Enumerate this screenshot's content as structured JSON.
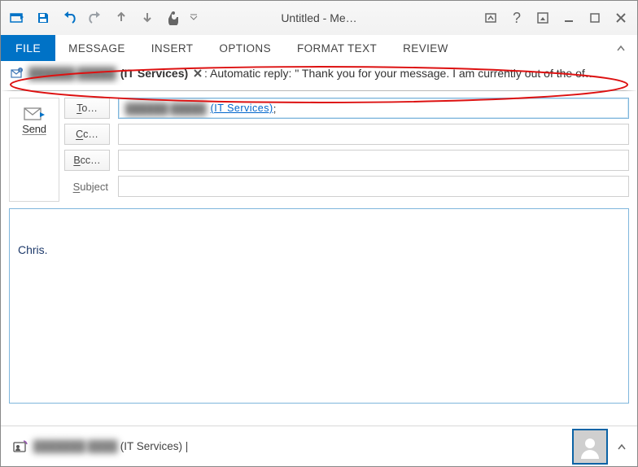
{
  "titlebar": {
    "title": "Untitled - Me…"
  },
  "tabs": {
    "file": "FILE",
    "message": "MESSAGE",
    "insert": "INSERT",
    "options": "OPTIONS",
    "format_text": "FORMAT TEXT",
    "review": "REVIEW"
  },
  "mailtip": {
    "redacted_name": "██████ █████",
    "it_dept": "(IT Services)",
    "line": " : Automatic reply: \"   Thank you for your message. I am currently out of the of…"
  },
  "compose": {
    "send_label": "Send",
    "to_label": "To…",
    "cc_label": "Cc…",
    "bcc_label": "Bcc…",
    "subject_label": "Subject",
    "to_value_redacted": "██████ █████",
    "to_value_link": "(IT Services)",
    "to_semicolon": ";",
    "cc_value": "",
    "bcc_value": "",
    "subject_value": ""
  },
  "body": {
    "text": "Chris."
  },
  "people": {
    "redacted_name": "███████ ████",
    "suffix": "(IT Services) |"
  },
  "icons": {
    "popout": "popout-icon",
    "save": "save-icon",
    "undo": "undo-icon",
    "redo": "redo-icon",
    "up": "up-icon",
    "down": "down-icon",
    "touch": "touch-icon",
    "minimize_ribbon": "chevron-up-icon",
    "help": "help-icon",
    "restore": "restore-icon",
    "minimize": "minimize-icon",
    "maximize": "maximize-icon",
    "close": "close-icon",
    "mail_info": "mail-info-icon",
    "remove": "remove-icon",
    "envelope_send": "envelope-icon",
    "contact_card": "contact-card-icon",
    "avatar": "avatar-placeholder-icon",
    "expand": "chevron-up-icon"
  }
}
